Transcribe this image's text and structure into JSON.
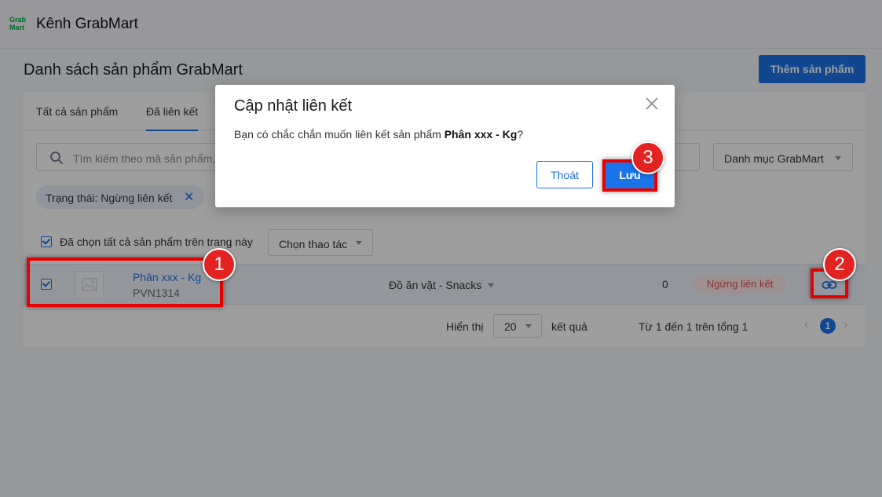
{
  "header": {
    "logo_text": "Grab Mart",
    "title": "Kênh GrabMart"
  },
  "page": {
    "title": "Danh sách sản phẩm GrabMart",
    "add_button": "Thêm sản phẩm"
  },
  "tabs": [
    {
      "label": "Tất cả sản phẩm",
      "active": false
    },
    {
      "label": "Đã liên kết",
      "active": true
    }
  ],
  "search": {
    "placeholder": "Tìm kiếm theo mã sản phẩm,"
  },
  "category_select": {
    "value": "Danh mục GrabMart"
  },
  "filter_tag": {
    "label": "Trạng thái: Ngừng liên kết",
    "remove": "✕"
  },
  "selection": {
    "select_all_label": "Đã chọn tất cả sản phẩm trên trang này",
    "action_label": "Chọn thao tác"
  },
  "products": [
    {
      "name": "Phân xxx - Kg",
      "sku": "PVN1314",
      "category": "Đồ ăn vặt - Snacks",
      "stock": "0",
      "status": "Ngừng liên kết"
    }
  ],
  "pagination": {
    "show_label": "Hiển thị",
    "page_size": "20",
    "result_label": "kết quả",
    "range_text": "Từ 1 đến 1 trên tổng 1",
    "prev": "‹",
    "current_page": "1",
    "next": "›"
  },
  "modal": {
    "title": "Cập nhật liên kết",
    "body_prefix": "Bạn có chắc chắn muốn liên kết sản phẩm ",
    "body_product": "Phân xxx - Kg",
    "body_suffix": "?",
    "cancel_label": "Thoát",
    "save_label": "Lưu"
  },
  "annotations": {
    "step1": "1",
    "step2": "2",
    "step3": "3"
  },
  "colors": {
    "primary": "#1a73e8",
    "brand": "#00b14f",
    "annotation_red": "#e32222",
    "status_bg": "#fde8e8",
    "status_text": "#e05252"
  }
}
